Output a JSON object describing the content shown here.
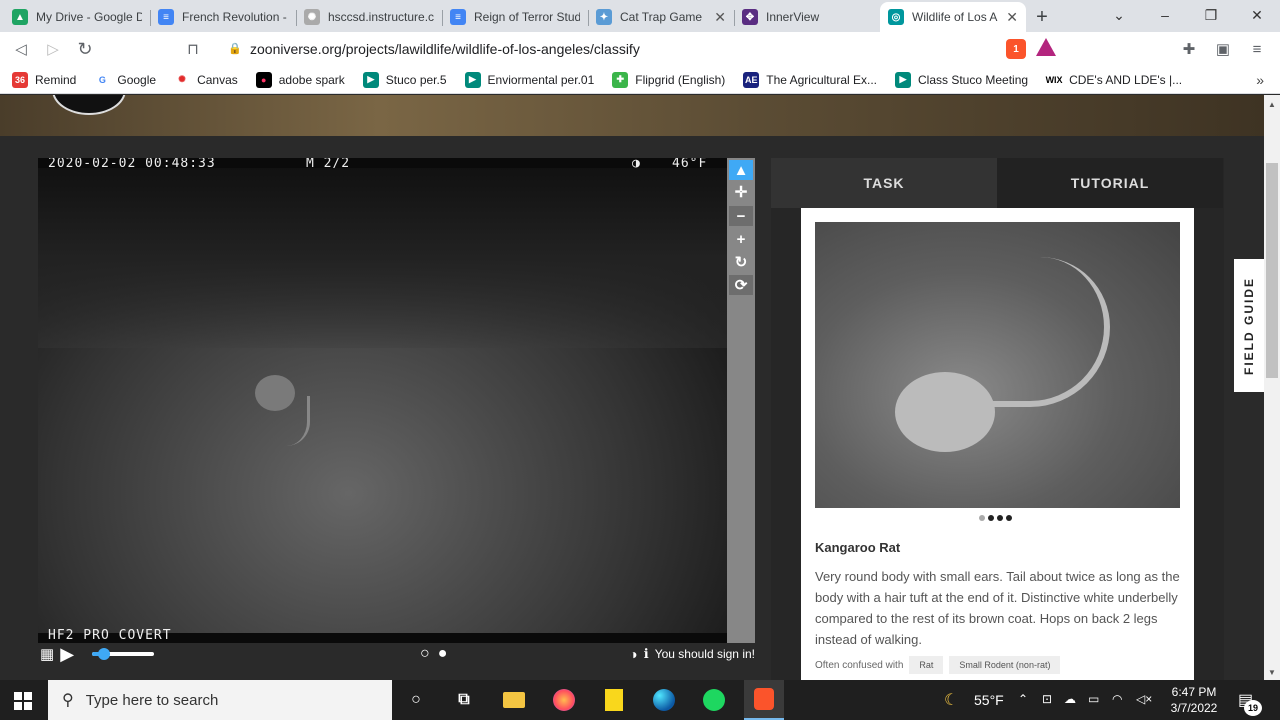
{
  "tabs": [
    {
      "title": "My Drive - Google D",
      "fav_color": "#1fa463",
      "fav": "▲"
    },
    {
      "title": "French Revolution -",
      "fav_color": "#4285f4",
      "fav": "≡"
    },
    {
      "title": "hsccsd.instructure.co",
      "fav_color": "#aaaaaa",
      "fav": "✺"
    },
    {
      "title": "Reign of Terror Stud",
      "fav_color": "#4285f4",
      "fav": "≡"
    },
    {
      "title": "Cat Trap Game",
      "fav_color": "#5a9bd5",
      "fav": "✦",
      "close": "✕"
    },
    {
      "title": "InnerView",
      "fav_color": "#5a2d82",
      "fav": "✥"
    },
    {
      "title": "Wildlife of Los A",
      "fav_color": "#00979d",
      "fav": "◎",
      "close": "✕",
      "active": true
    }
  ],
  "window": {
    "new_tab": "+",
    "menu": "⌄",
    "minimize": "–",
    "restore": "❐",
    "close": "✕"
  },
  "toolbar": {
    "back": "◁",
    "forward": "▷",
    "reload": "↻",
    "bookmark": "⊓",
    "url": "zooniverse.org/projects/lawildlife/wildlife-of-los-angeles/classify",
    "brave_badge": "1",
    "extensions": "✚",
    "wallet": "▣",
    "menu": "≡"
  },
  "bookmarks": [
    {
      "label": "Remind",
      "fav": "36",
      "color": "#e53935"
    },
    {
      "label": "Google",
      "fav": "G",
      "color": "#ffffff",
      "text": "#4285f4"
    },
    {
      "label": "Canvas",
      "fav": "✺",
      "color": "#ffffff",
      "text": "#e22b2b"
    },
    {
      "label": "adobe spark",
      "fav": "●",
      "color": "#000000",
      "text": "#ff3366"
    },
    {
      "label": "Stuco per.5",
      "fav": "▶",
      "color": "#00897b"
    },
    {
      "label": "Enviormental per.01",
      "fav": "▶",
      "color": "#00897b"
    },
    {
      "label": "Flipgrid (English)",
      "fav": "✚",
      "color": "#3bb54a"
    },
    {
      "label": "The Agricultural Ex...",
      "fav": "AE",
      "color": "#1a237e"
    },
    {
      "label": "Class Stuco Meeting",
      "fav": "▶",
      "color": "#00897b"
    },
    {
      "label": "CDE's AND LDE's |...",
      "fav": "WIX",
      "color": "#ffffff",
      "text": "#000000"
    }
  ],
  "bookmarks_more": "»",
  "subject": {
    "date": "2020-02-02 00:48:33",
    "mode": "M 2/2",
    "moon": "◑",
    "temp": "46°F",
    "footer": "HF2 PRO COVERT"
  },
  "tools": [
    "▲",
    "✛",
    "−",
    "+",
    "↻",
    "⟳"
  ],
  "controls": {
    "grid": "▦",
    "play": "▶",
    "prev_frame": "○",
    "cur_frame": "●",
    "contrast": "◑",
    "info": "ℹ",
    "signin": "You should sign in!"
  },
  "panel": {
    "tab_task": "TASK",
    "tab_tutorial": "TUTORIAL"
  },
  "card": {
    "title": "Kangaroo Rat",
    "description": "Very round body with small ears. Tail about twice as long as the body with a hair tuft at the end of it. Distinctive white underbelly compared to the rest of its brown coat. Hops on back 2 legs instead of walking.",
    "confused_label": "Often confused with",
    "confused": [
      "Rat",
      "Small Rodent (non-rat)"
    ]
  },
  "field_guide": "FIELD GUIDE",
  "taskbar": {
    "search_placeholder": "Type here to search",
    "weather": "55°F",
    "time": "6:47 PM",
    "date": "3/7/2022",
    "notif": "19"
  }
}
